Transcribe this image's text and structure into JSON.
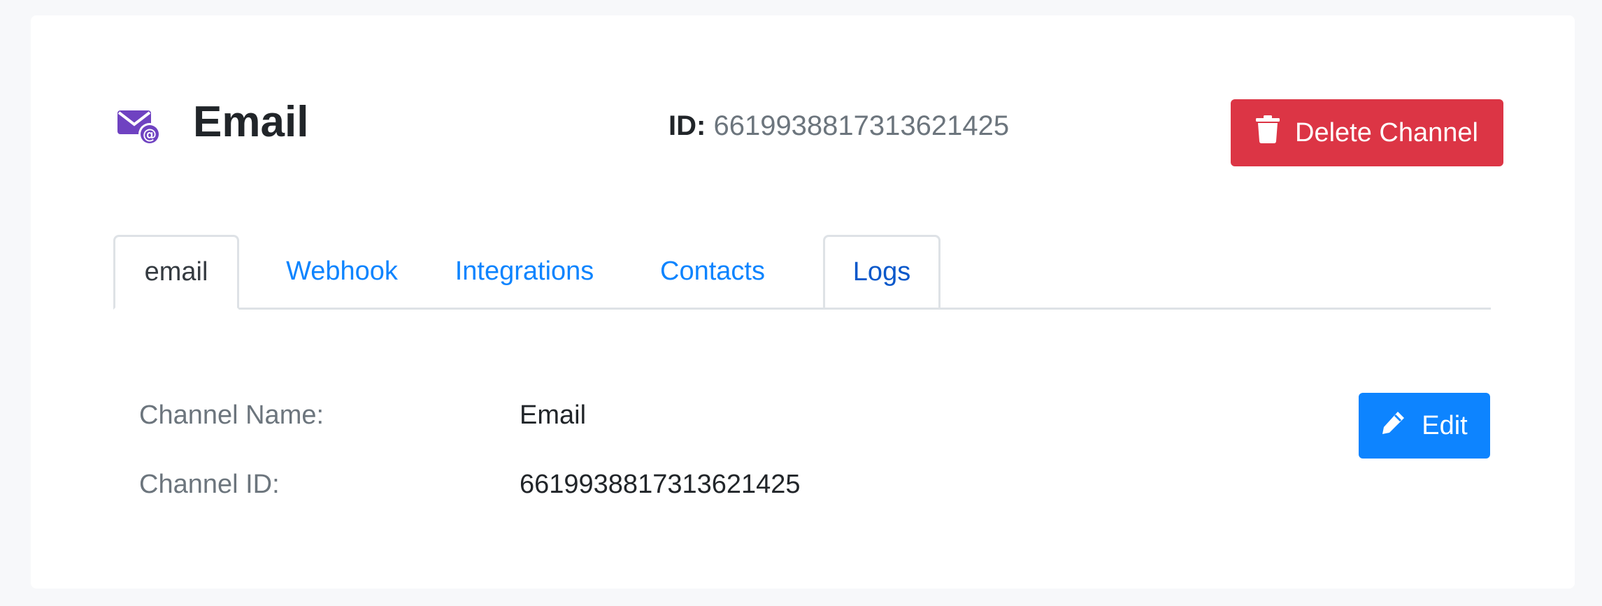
{
  "channel": {
    "title": "Email",
    "icon": "email-at-icon",
    "id_label": "ID:",
    "id_value": "6619938817313621425"
  },
  "actions": {
    "delete_label": "Delete Channel",
    "delete_icon": "trash-icon",
    "edit_label": "Edit",
    "edit_icon": "pencil-icon"
  },
  "tabs": [
    {
      "label": "email",
      "active": true
    },
    {
      "label": "Webhook",
      "active": false
    },
    {
      "label": "Integrations",
      "active": false
    },
    {
      "label": "Contacts",
      "active": false
    },
    {
      "label": "Logs",
      "active": false
    }
  ],
  "details": {
    "name_label": "Channel Name:",
    "name_value": "Email",
    "id_label": "Channel ID:",
    "id_value": "6619938817313621425"
  },
  "colors": {
    "accent": "#0d84ff",
    "danger": "#dc3545",
    "icon": "#6f42c1"
  }
}
